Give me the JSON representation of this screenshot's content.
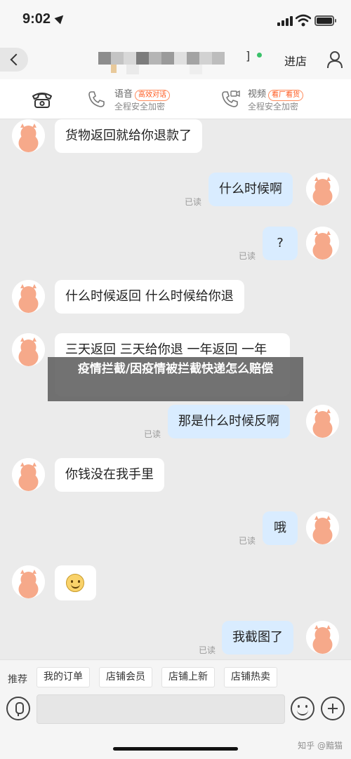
{
  "status_bar": {
    "time": "9:02"
  },
  "nav": {
    "enter_shop": "进店"
  },
  "service": {
    "items": [
      {
        "title": "语音",
        "tag": "高效对话",
        "sub": "全程安全加密"
      },
      {
        "title": "视频",
        "tag": "看厂看货",
        "sub": "全程安全加密"
      }
    ]
  },
  "messages": [
    {
      "side": "in",
      "text": "货物返回就给你退款了"
    },
    {
      "side": "out",
      "text": "什么时候啊",
      "status": "已读"
    },
    {
      "side": "out",
      "text": "?",
      "status": "已读"
    },
    {
      "side": "in",
      "text": "什么时候返回 什么时候给你退"
    },
    {
      "side": "in",
      "text": "三天返回 三天给你退 一年返回 一年"
    },
    {
      "side": "out",
      "text": "那是什么时候反啊",
      "status": "已读"
    },
    {
      "side": "in",
      "text": "你钱没在我手里"
    },
    {
      "side": "out",
      "text": "哦",
      "status": "已读"
    },
    {
      "side": "in",
      "text": "",
      "emoji": "smile"
    },
    {
      "side": "out",
      "text": "我截图了",
      "status": "已读"
    }
  ],
  "overlay": {
    "text": "疫情拦截/因疫情被拦截快递怎么赔偿"
  },
  "quick_bar": {
    "label": "推荐",
    "chips": [
      "我的订单",
      "店铺会员",
      "店铺上新",
      "店铺热卖"
    ]
  },
  "input": {
    "value": ""
  },
  "watermark": "知乎 @黯猫",
  "colors": {
    "tag": "#ff5a1f",
    "bubble_out": "#d9ecff",
    "bubble_in": "#ffffff",
    "online": "#3ac16a"
  }
}
